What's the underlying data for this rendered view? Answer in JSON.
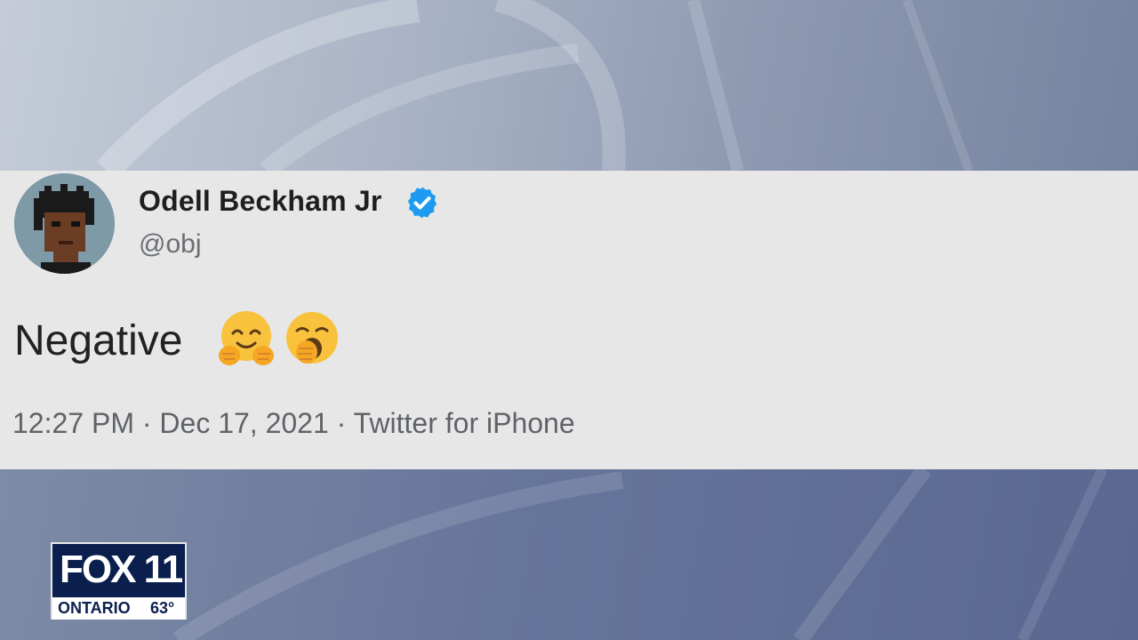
{
  "tweet": {
    "author_name": "Odell Beckham Jr",
    "handle": "@obj",
    "text": "Negative",
    "emojis": [
      "hugging-face",
      "yawning-face"
    ],
    "timestamp": "12:27 PM",
    "date": "Dec 17, 2021",
    "source": "Twitter for iPhone",
    "separator": "·",
    "verified": true
  },
  "broadcast": {
    "brand": "FOX 11",
    "city": "ONTARIO",
    "temperature": "63°",
    "brand_color": "#0b1f4e"
  },
  "colors": {
    "verified_badge": "#1d9bf0",
    "card_background": "#e7e7e7"
  }
}
